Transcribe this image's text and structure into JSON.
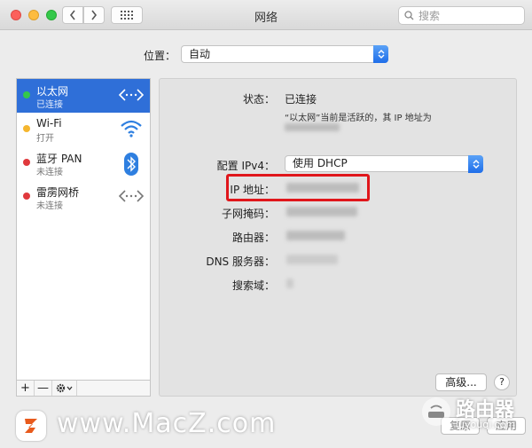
{
  "window": {
    "title": "网络"
  },
  "search": {
    "placeholder": "搜索"
  },
  "location": {
    "label": "位置：",
    "value": "自动"
  },
  "services": [
    {
      "name": "以太网",
      "status": "已连接",
      "status_color": "#34c84a",
      "icon": "ethernet-icon",
      "selected": true
    },
    {
      "name": "Wi-Fi",
      "status": "打开",
      "status_color": "#f5b62f",
      "icon": "wifi-icon",
      "selected": false
    },
    {
      "name": "蓝牙 PAN",
      "status": "未连接",
      "status_color": "#e0393d",
      "icon": "bluetooth-icon",
      "selected": false
    },
    {
      "name": "雷雳网桥",
      "status": "未连接",
      "status_color": "#e0393d",
      "icon": "ethernet-icon",
      "selected": false
    }
  ],
  "sidebar_toolbar": {
    "add": "+",
    "remove": "—"
  },
  "detail": {
    "status_label": "状态：",
    "status_value": "已连接",
    "status_note": "“以太网”当前是活跃的，其 IP 地址为",
    "configure_label": "配置 IPv4：",
    "configure_value": "使用 DHCP",
    "ip_label": "IP 地址：",
    "subnet_label": "子网掩码：",
    "router_label": "路由器：",
    "dns_label": "DNS 服务器：",
    "search_domain_label": "搜索域："
  },
  "buttons": {
    "advanced": "高级...",
    "help": "?",
    "revert": "复原",
    "apply": "应用"
  },
  "watermark": {
    "site": "www.MacZ.com",
    "logo_letter": "Z",
    "router_name": "路由器",
    "router_url": "luyouqi.com"
  },
  "colors": {
    "accent": "#2f6fd8",
    "highlight": "#e0161b"
  }
}
